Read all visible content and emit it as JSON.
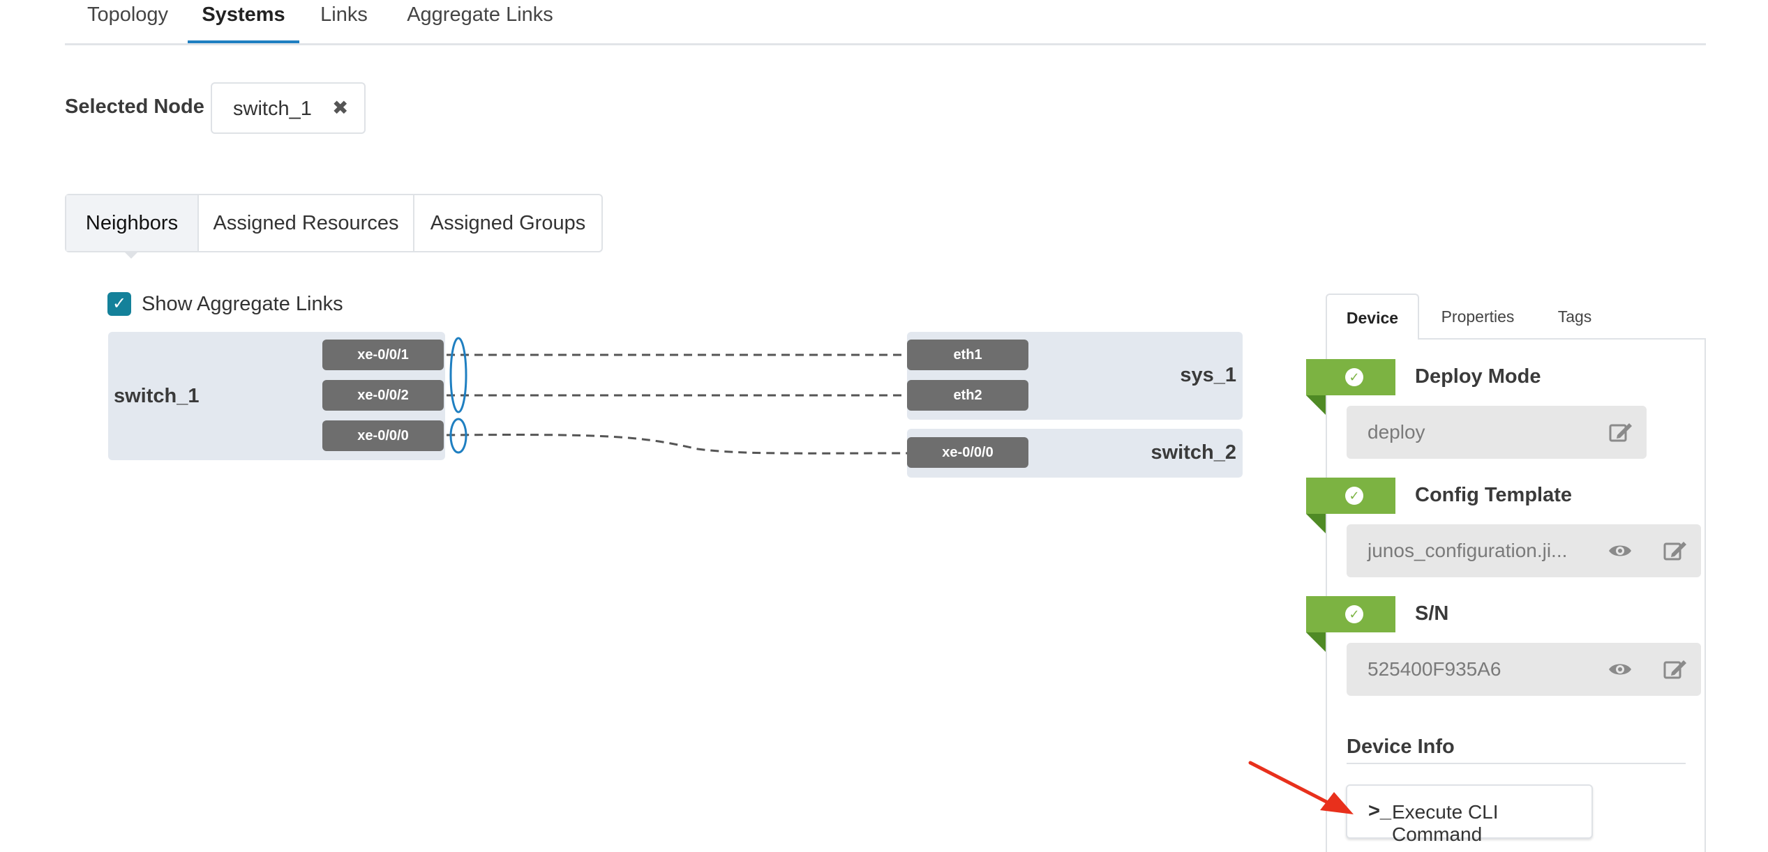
{
  "top_tabs": [
    {
      "label": "Topology"
    },
    {
      "label": "Systems"
    },
    {
      "label": "Links"
    },
    {
      "label": "Aggregate Links"
    }
  ],
  "selected_node": {
    "label": "Selected Node",
    "value": "switch_1",
    "clear_icon": "✖"
  },
  "sub_tabs": [
    {
      "label": "Neighbors"
    },
    {
      "label": "Assigned Resources"
    },
    {
      "label": "Assigned Groups"
    }
  ],
  "show_aggregate": {
    "label": "Show Aggregate Links",
    "checked": true,
    "check_icon": "✓"
  },
  "topology": {
    "source": {
      "name": "switch_1",
      "ports": [
        "xe-0/0/1",
        "xe-0/0/2",
        "xe-0/0/0"
      ]
    },
    "targets": [
      {
        "name": "sys_1",
        "ports": [
          "eth1",
          "eth2"
        ]
      },
      {
        "name": "switch_2",
        "ports": [
          "xe-0/0/0"
        ]
      }
    ]
  },
  "right_panel": {
    "tabs": [
      {
        "label": "Device"
      },
      {
        "label": "Properties"
      },
      {
        "label": "Tags"
      }
    ],
    "properties": [
      {
        "title": "Deploy Mode",
        "value": "deploy",
        "status_icon": "✓"
      },
      {
        "title": "Config Template",
        "value": "junos_configuration.ji...",
        "status_icon": "✓"
      },
      {
        "title": "S/N",
        "value": "525400F935A6",
        "status_icon": "✓"
      }
    ],
    "device_info": {
      "title": "Device Info",
      "button_prompt": ">_",
      "button_label": "Execute CLI Command"
    }
  },
  "colors": {
    "accent_blue": "#1f7fc1",
    "checkbox_teal": "#14819a",
    "status_green": "#7cb342",
    "annotation_red": "#e8301c"
  }
}
